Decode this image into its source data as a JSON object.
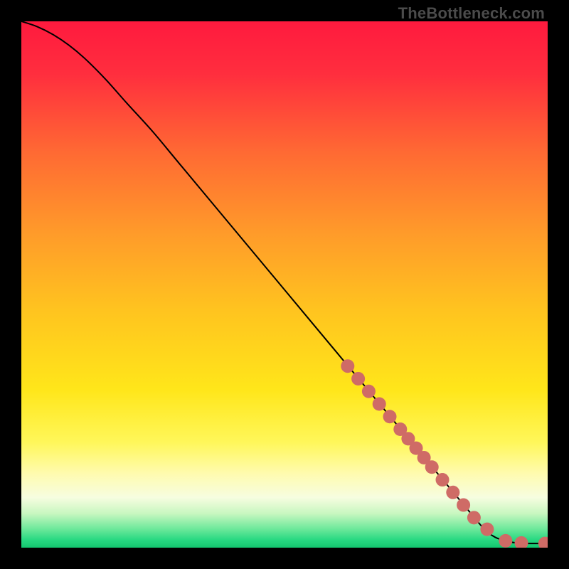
{
  "watermark": "TheBottleneck.com",
  "colors": {
    "bg": "#000000",
    "gradient_stops": [
      {
        "offset": 0.0,
        "color": "#ff1a3e"
      },
      {
        "offset": 0.1,
        "color": "#ff2e3e"
      },
      {
        "offset": 0.25,
        "color": "#ff6a33"
      },
      {
        "offset": 0.4,
        "color": "#ff9a2a"
      },
      {
        "offset": 0.55,
        "color": "#ffc41f"
      },
      {
        "offset": 0.7,
        "color": "#ffe61a"
      },
      {
        "offset": 0.8,
        "color": "#fff75a"
      },
      {
        "offset": 0.86,
        "color": "#fffbb0"
      },
      {
        "offset": 0.905,
        "color": "#f6fde0"
      },
      {
        "offset": 0.935,
        "color": "#c8f7c0"
      },
      {
        "offset": 0.965,
        "color": "#6be89a"
      },
      {
        "offset": 0.985,
        "color": "#28d982"
      },
      {
        "offset": 1.0,
        "color": "#14c66f"
      }
    ],
    "line": "#000000",
    "marker_fill": "#cf6b66",
    "marker_stroke": "#b85650"
  },
  "chart_data": {
    "type": "line",
    "title": "",
    "xlabel": "",
    "ylabel": "",
    "xlim": [
      0,
      100
    ],
    "ylim": [
      0,
      100
    ],
    "grid": false,
    "legend": false,
    "series": [
      {
        "name": "curve",
        "x": [
          0,
          3,
          6,
          9,
          12,
          16,
          20,
          25,
          30,
          40,
          50,
          60,
          70,
          80,
          85,
          88,
          90,
          92,
          94,
          96,
          98,
          100
        ],
        "y": [
          100,
          99,
          97.5,
          95.5,
          93,
          89,
          84.5,
          79,
          73,
          61,
          49,
          37,
          25,
          13,
          7,
          3.5,
          2,
          1.3,
          0.9,
          0.8,
          0.8,
          0.8
        ]
      }
    ],
    "markers": {
      "name": "highlighted-range",
      "x": [
        62,
        64,
        66,
        68,
        70,
        72,
        73.5,
        75,
        76.5,
        78,
        80,
        82,
        84,
        86,
        88.5,
        92,
        95,
        99.5
      ],
      "y": [
        34.5,
        32.1,
        29.7,
        27.3,
        24.9,
        22.5,
        20.7,
        18.9,
        17.1,
        15.3,
        12.9,
        10.5,
        8.1,
        5.7,
        3.5,
        1.3,
        0.9,
        0.8
      ]
    }
  }
}
